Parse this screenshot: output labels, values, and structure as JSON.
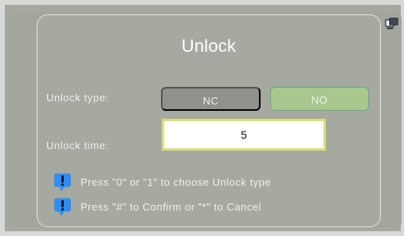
{
  "dialog": {
    "title": "Unlock",
    "unlock_type_label": "Unlock type:",
    "unlock_time_label": "Unlock time:",
    "unlock_type_options": [
      {
        "label": "NC",
        "selected": false
      },
      {
        "label": "NO",
        "selected": true
      }
    ],
    "unlock_time_value": "5",
    "hints": [
      "Press \"0\" or \"1\" to choose Unlock type",
      "Press \"#\" to Confirm or \"*\" to Cancel"
    ]
  },
  "icons": {
    "hint_icon": "info-icon",
    "top_right_icon": "window-icon"
  },
  "colors": {
    "background": "#a5a89f",
    "selected_option": "#a8c88d",
    "unselected_option": "#8f918d",
    "input_border": "#d9dd76",
    "info_blue": "#2f8ef1"
  }
}
